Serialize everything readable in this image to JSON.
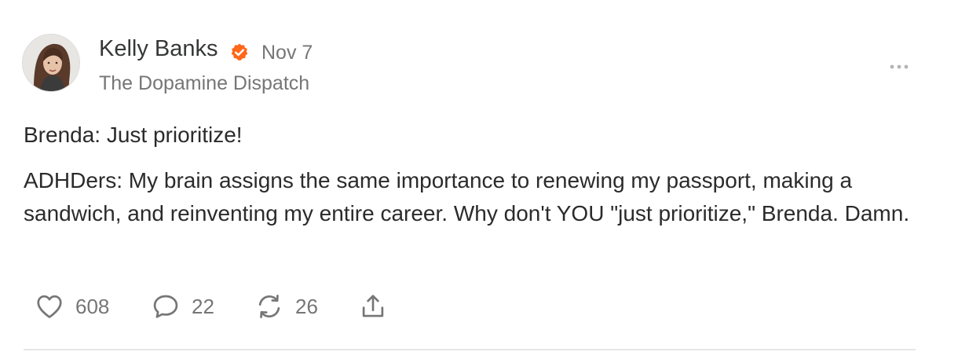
{
  "note": {
    "author": {
      "name": "Kelly Banks",
      "verified": true,
      "avatar_icon": "avatar-portrait"
    },
    "timestamp": "Nov 7",
    "publication": "The Dopamine Dispatch",
    "menu_icon": "more-icon",
    "paragraphs": [
      "Brenda: Just prioritize!",
      "ADHDers: My brain assigns the same importance to renewing my passport, making a sandwich, and reinventing my entire career. Why don't YOU \"just prioritize,\" Brenda. Damn."
    ],
    "actions": {
      "like": {
        "icon": "heart-icon",
        "count": "608"
      },
      "comment": {
        "icon": "comment-icon",
        "count": "22"
      },
      "restack": {
        "icon": "restack-icon",
        "count": "26"
      },
      "share": {
        "icon": "share-icon"
      }
    }
  },
  "colors": {
    "accent": "#ff6719",
    "text": "#2b2b2b",
    "muted": "#767676",
    "icon": "#767676",
    "divider": "#e6e6e6"
  }
}
